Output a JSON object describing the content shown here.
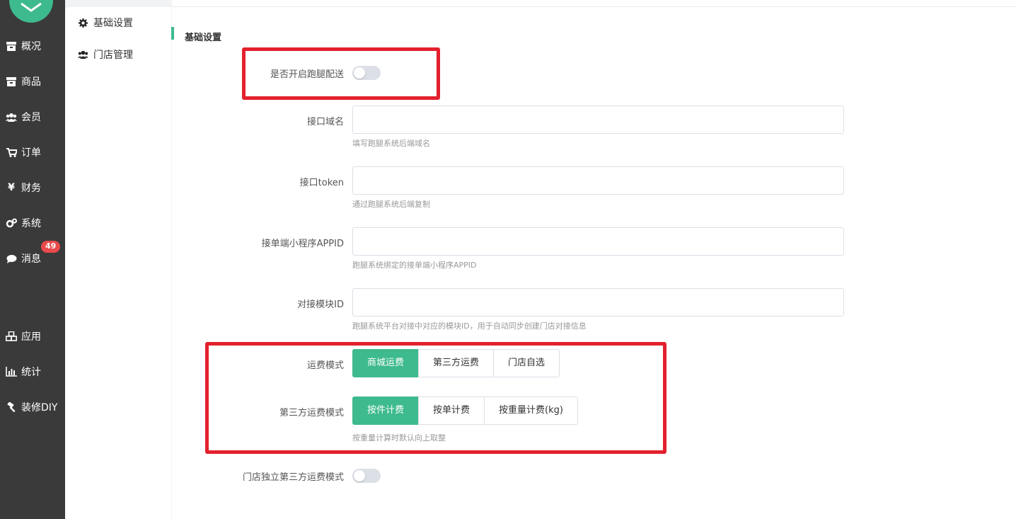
{
  "nav": {
    "items": [
      {
        "label": "概况",
        "icon": "box-icon"
      },
      {
        "label": "商品",
        "icon": "box-icon"
      },
      {
        "label": "会员",
        "icon": "users-icon"
      },
      {
        "label": "订单",
        "icon": "cart-icon"
      },
      {
        "label": "财务",
        "icon": "yen-icon"
      },
      {
        "label": "系统",
        "icon": "gears-icon"
      },
      {
        "label": "消息",
        "icon": "chat-icon"
      },
      {
        "label": "应用",
        "icon": "cubes-icon"
      },
      {
        "label": "统计",
        "icon": "bar-chart-icon"
      },
      {
        "label": "装修DIY",
        "icon": "hammer-icon"
      }
    ],
    "message_badge": "49"
  },
  "subnav": {
    "items": [
      {
        "label": "基础设置",
        "icon": "gear-icon"
      },
      {
        "label": "门店管理",
        "icon": "users-icon"
      }
    ]
  },
  "section_title": "基础设置",
  "form": {
    "enable_delivery": {
      "label": "是否开启跑腿配送",
      "checked": false
    },
    "api_domain": {
      "label": "接口域名",
      "value": "",
      "hint": "填写跑腿系统后端域名"
    },
    "api_token": {
      "label": "接口token",
      "value": "",
      "hint": "通过跑腿系统后端复制"
    },
    "miniapp_appid": {
      "label": "接单端小程序APPID",
      "value": "",
      "hint": "跑腿系统绑定的接单端小程序APPID"
    },
    "module_id": {
      "label": "对接模块ID",
      "value": "",
      "hint": "跑腿系统平台对接中对应的模块ID，用于自动同步创建门店对接信息"
    },
    "freight_mode": {
      "label": "运费模式",
      "options": [
        "商城运费",
        "第三方运费",
        "门店自选"
      ],
      "selected": "商城运费"
    },
    "third_freight_mode": {
      "label": "第三方运费模式",
      "options": [
        "按件计费",
        "按单计费",
        "按重量计费(kg)"
      ],
      "selected": "按件计费",
      "hint": "按重量计算时默认向上取整"
    },
    "store_independent": {
      "label": "门店独立第三方运费模式",
      "checked": false
    }
  },
  "colors": {
    "accent": "#3dba8e",
    "sidebar": "#3a3a3a",
    "highlight": "#e3212e",
    "badge": "#e84a4a"
  }
}
